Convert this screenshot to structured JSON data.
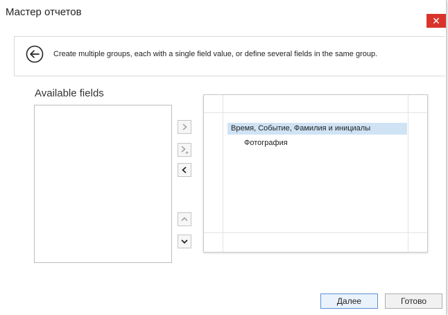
{
  "window": {
    "title": "Мастер отчетов",
    "close_glyph": "✕"
  },
  "header": {
    "back_icon": "arrow-left-circle-icon",
    "text": "Create multiple groups, each with a single field value, or define several fields in the same group."
  },
  "available_fields": {
    "label": "Available fields",
    "items": []
  },
  "move_buttons": {
    "add": "chevron-right-icon",
    "add_to_group": "chevron-right-plus-icon",
    "remove": "chevron-left-icon",
    "move_up": "chevron-up-icon",
    "move_down": "chevron-down-icon"
  },
  "groups": [
    {
      "label": "Время, Событие, Фамилия и инициалы",
      "selected": true
    },
    {
      "label": "Фотография",
      "selected": false
    }
  ],
  "footer": {
    "next_label": "Далее",
    "finish_label": "Готово"
  },
  "colors": {
    "close": "#d9342b",
    "selection": "#cfe3f4",
    "primary_border": "#5c8fd6"
  }
}
